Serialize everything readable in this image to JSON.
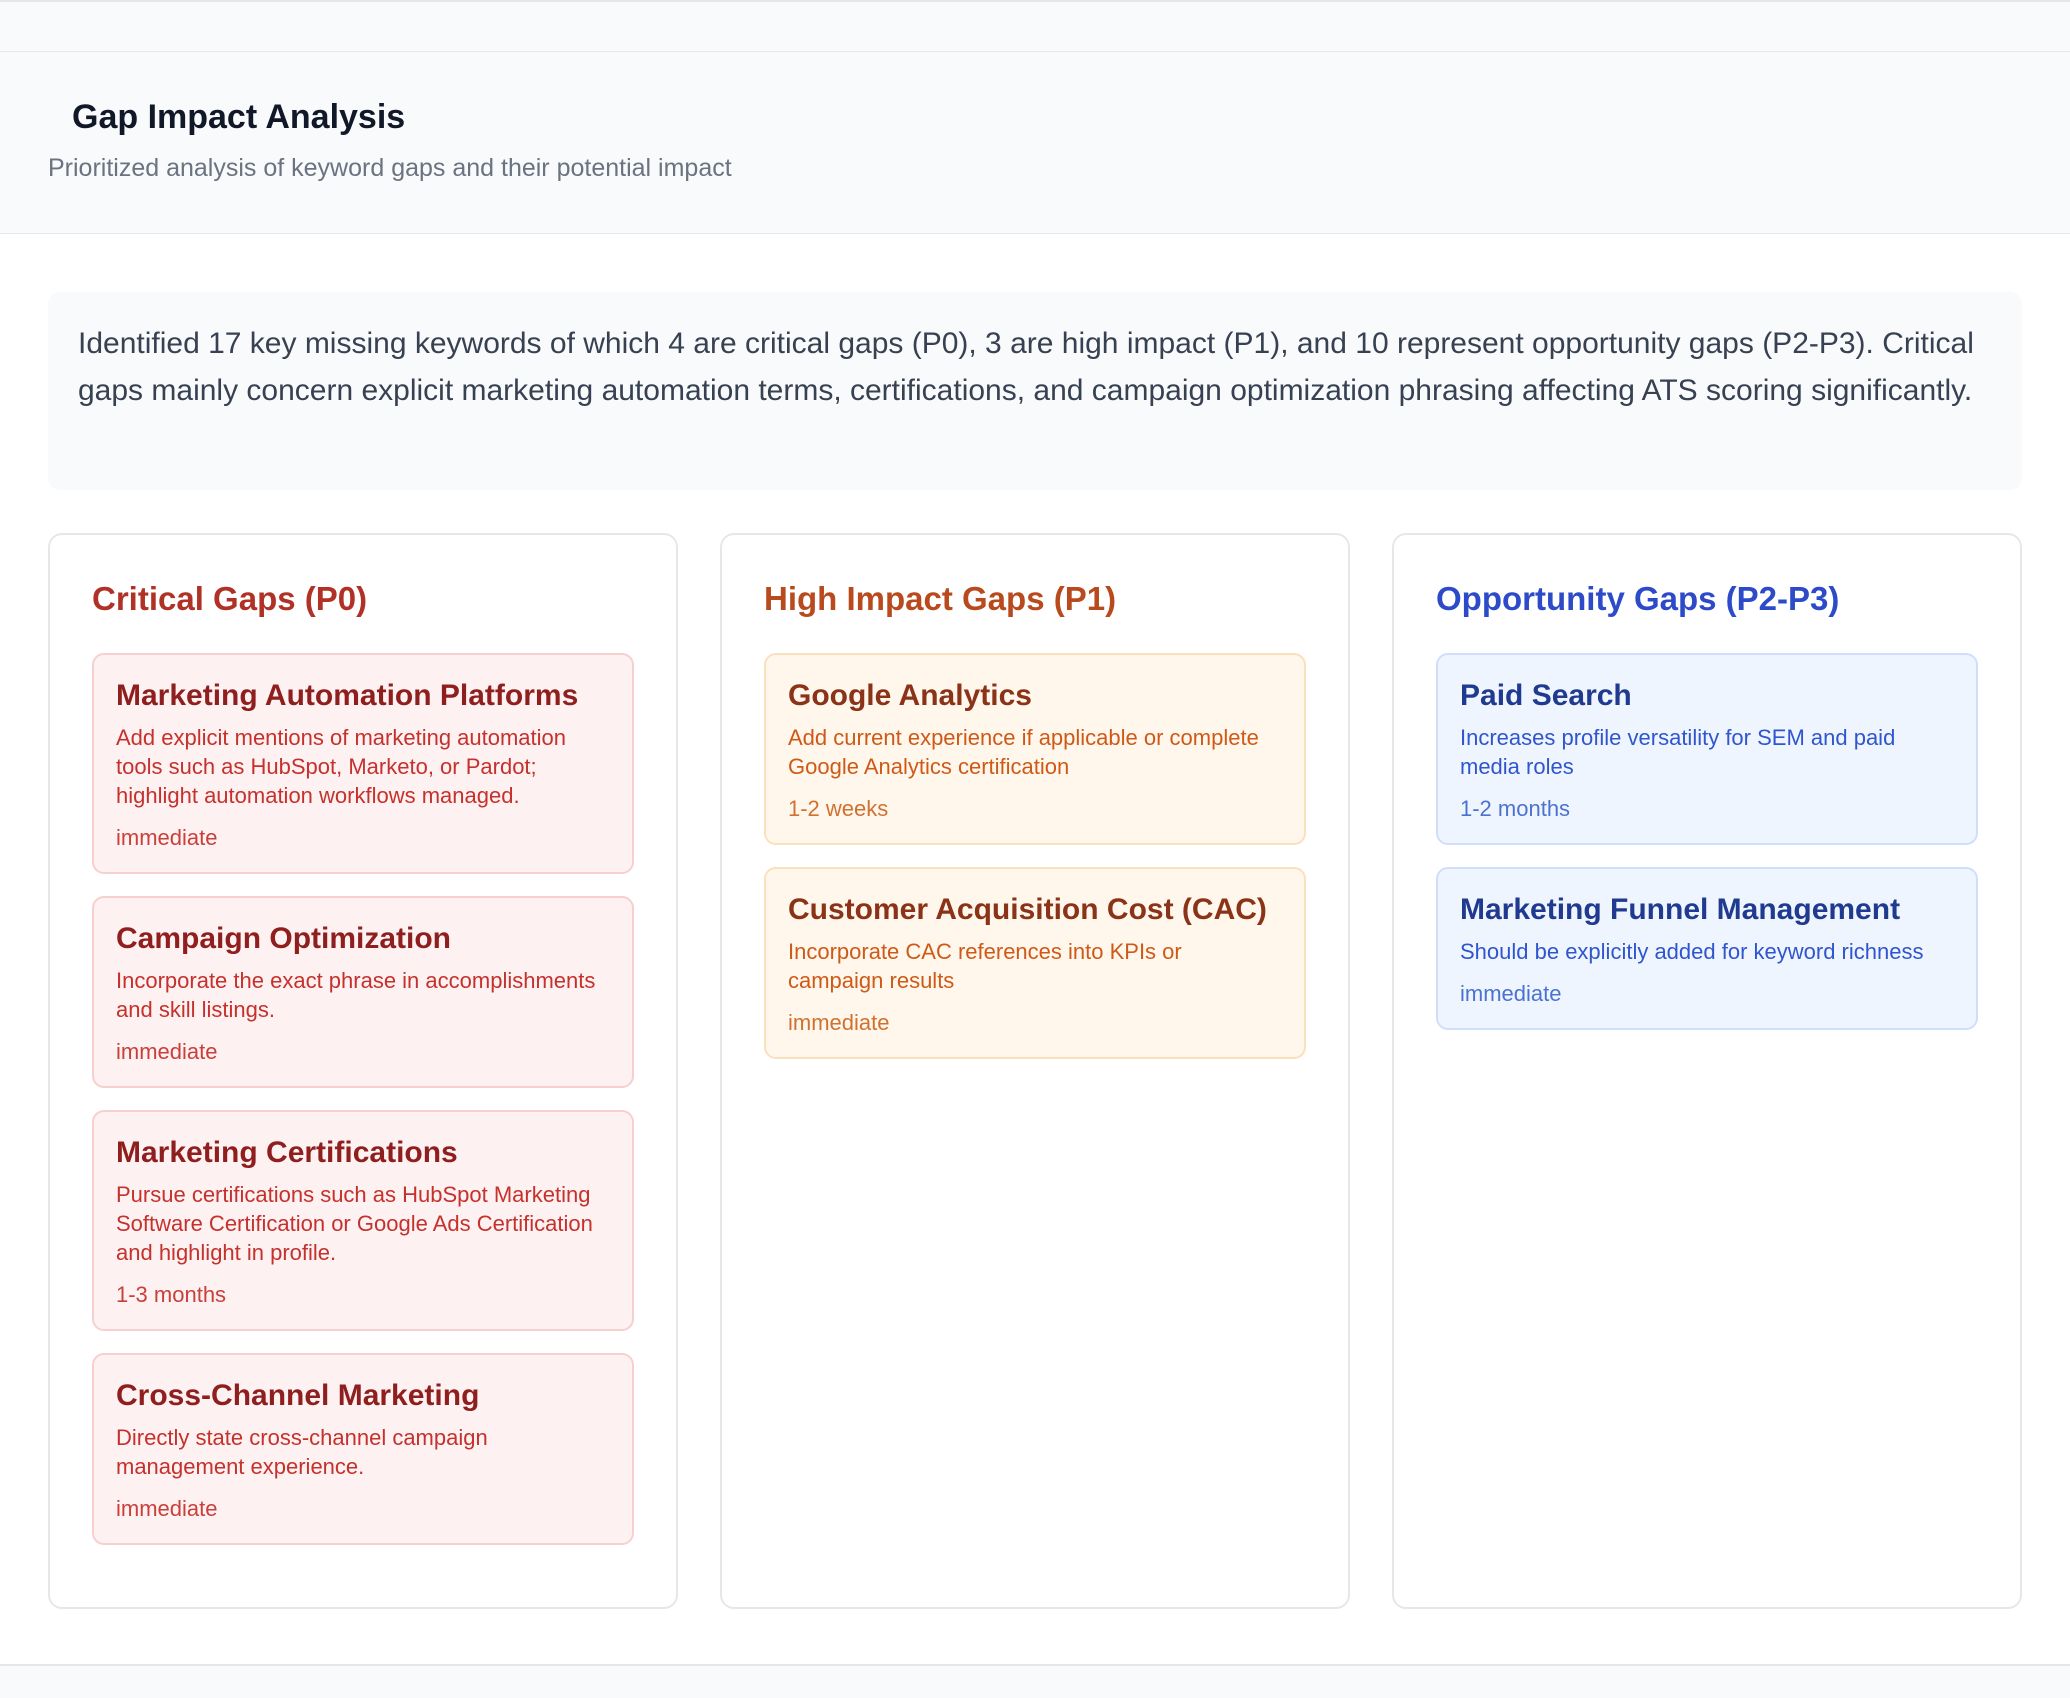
{
  "header": {
    "title": "Gap Impact Analysis",
    "subtitle": "Prioritized analysis of keyword gaps and their potential impact"
  },
  "summary": {
    "text": "Identified 17 key missing keywords of which 4 are critical gaps (P0), 3 are high impact (P1), and 10 represent opportunity gaps (P2-P3). Critical gaps mainly concern explicit marketing automation terms, certifications, and campaign optimization phrasing affecting ATS scoring significantly."
  },
  "colors": {
    "critical": "#b03226",
    "high": "#b84a1e",
    "opportunity": "#2d4bc9"
  },
  "columns": {
    "critical": {
      "title": "Critical Gaps (P0)",
      "items": [
        {
          "title": "Marketing Automation Platforms",
          "description": "Add explicit mentions of marketing automation tools such as HubSpot, Marketo, or Pardot; highlight automation workflows managed.",
          "timeframe": "immediate"
        },
        {
          "title": "Campaign Optimization",
          "description": "Incorporate the exact phrase in accomplishments and skill listings.",
          "timeframe": "immediate"
        },
        {
          "title": "Marketing Certifications",
          "description": "Pursue certifications such as HubSpot Marketing Software Certification or Google Ads Certification and highlight in profile.",
          "timeframe": "1-3 months"
        },
        {
          "title": "Cross-Channel Marketing",
          "description": "Directly state cross-channel campaign management experience.",
          "timeframe": "immediate"
        }
      ]
    },
    "high": {
      "title": "High Impact Gaps (P1)",
      "items": [
        {
          "title": "Google Analytics",
          "description": "Add current experience if applicable or complete Google Analytics certification",
          "timeframe": "1-2 weeks"
        },
        {
          "title": "Customer Acquisition Cost (CAC)",
          "description": "Incorporate CAC references into KPIs or campaign results",
          "timeframe": "immediate"
        }
      ]
    },
    "opportunity": {
      "title": "Opportunity Gaps (P2-P3)",
      "items": [
        {
          "title": "Paid Search",
          "description": "Increases profile versatility for SEM and paid media roles",
          "timeframe": "1-2 months"
        },
        {
          "title": "Marketing Funnel Management",
          "description": "Should be explicitly added for keyword richness",
          "timeframe": "immediate"
        }
      ]
    }
  }
}
